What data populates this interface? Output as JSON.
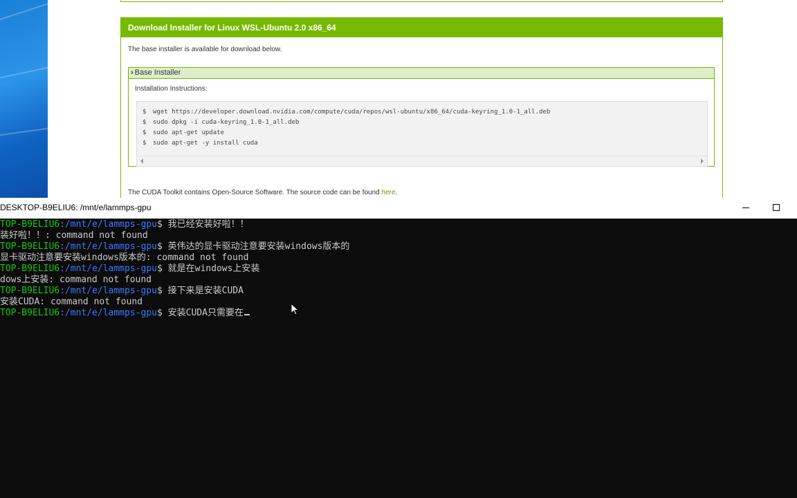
{
  "browser": {
    "download_header": "Download Installer for Linux WSL-Ubuntu 2.0 x86_64",
    "available_text": "The base installer is available for download below.",
    "base_installer": {
      "title": "Base Installer",
      "instructions_label": "Installation Instructions:",
      "commands": [
        {
          "prompt": "$",
          "cmd": "wget https://developer.download.nvidia.com/compute/cuda/repos/wsl-ubuntu/x86_64/cuda-keyring_1.0-1_all.deb"
        },
        {
          "prompt": "$",
          "cmd": "sudo dpkg -i cuda-keyring_1.0-1_all.deb"
        },
        {
          "prompt": "$",
          "cmd": "sudo apt-get update"
        },
        {
          "prompt": "$",
          "cmd": "sudo apt-get -y install cuda"
        }
      ]
    },
    "opensource_text": "The CUDA Toolkit contains Open-Source Software. The source code can be found ",
    "opensource_link": "here",
    "opensource_end": ".",
    "accent_color": "#76b900"
  },
  "terminal": {
    "title": "DESKTOP-B9ELIU6: /mnt/e/lammps-gpu",
    "prompt_host": "TOP-B9ELIU6",
    "prompt_path": ":/mnt/e/lammps-gpu",
    "prompt_dollar": "$ ",
    "lines": [
      {
        "type": "prompt",
        "text": "我已经安装好啦！！"
      },
      {
        "type": "output",
        "text": "装好啦！！: command not found"
      },
      {
        "type": "prompt",
        "text": "英伟达的显卡驱动注意要安装windows版本的"
      },
      {
        "type": "output",
        "text": "显卡驱动注意要安装windows版本的: command not found"
      },
      {
        "type": "prompt",
        "text": "就是在windows上安装"
      },
      {
        "type": "output",
        "text": "dows上安装: command not found"
      },
      {
        "type": "prompt",
        "text": "接下来是安装CUDA"
      },
      {
        "type": "output",
        "text": "安装CUDA: command not found"
      },
      {
        "type": "prompt",
        "text": "安装CUDA只需要在"
      }
    ],
    "host_color": "#16c60c",
    "path_color": "#3b78ff"
  }
}
